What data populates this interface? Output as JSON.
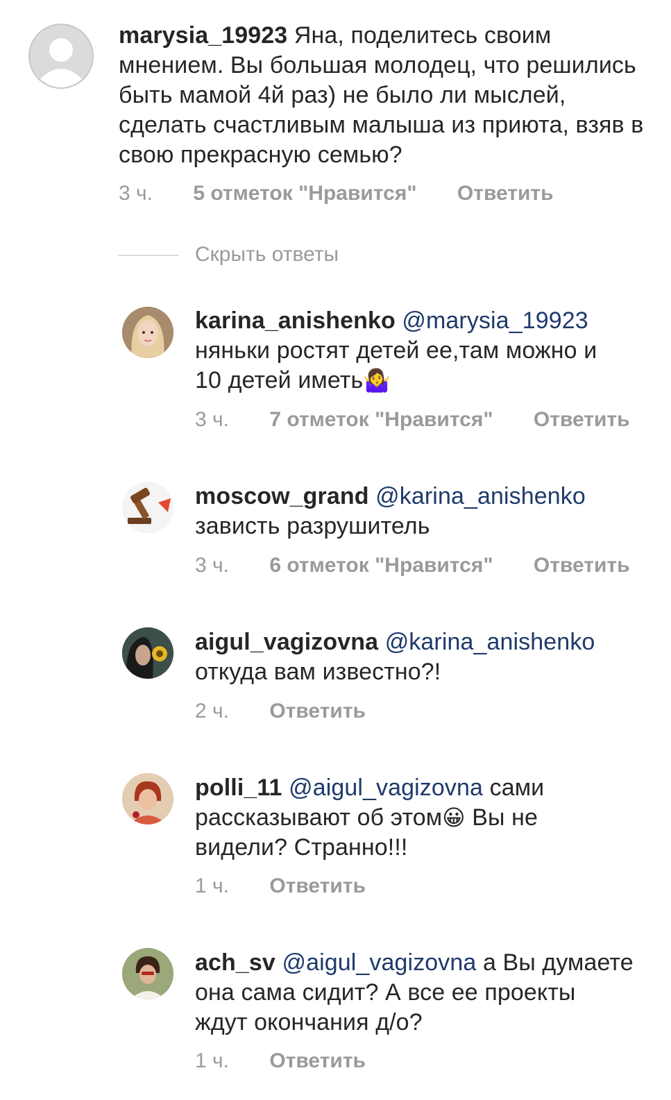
{
  "main_comment": {
    "username": "marysia_19923",
    "text": " Яна, поделитесь своим мнением. Вы большая молодец, что решились быть мамой 4й раз) не было ли мыслей, сделать счастливым малыша из приюта, взяв в свою прекрасную семью?",
    "time": "3 ч.",
    "likes": "5 отметок \"Нравится\"",
    "reply": "Ответить"
  },
  "hide_replies": "Скрыть ответы",
  "replies": [
    {
      "username": "karina_anishenko",
      "mention": "@marysia_19923",
      "text_line1": "няньки ростят детей ее,там можно и",
      "text_line2": "10 детей иметь",
      "emoji": "🤷‍♀️",
      "time": "3 ч.",
      "likes": "7 отметок \"Нравится\"",
      "reply": "Ответить"
    },
    {
      "username": "moscow_grand",
      "mention": "@karina_anishenko",
      "text": "зависть разрушитель",
      "time": "3 ч.",
      "likes": "6 отметок \"Нравится\"",
      "reply": "Ответить"
    },
    {
      "username": "aigul_vagizovna",
      "mention": "@karina_anishenko",
      "text": "откуда вам известно?!",
      "time": "2 ч.",
      "reply": "Ответить"
    },
    {
      "username": "polli_11",
      "mention": "@aigul_vagizovna",
      "text_a": " сами",
      "text_line2a": "рассказывают об этом",
      "emoji": "😀",
      "text_line2b": " Вы не",
      "text_line3": "видели? Странно!!!",
      "time": "1 ч.",
      "reply": "Ответить"
    },
    {
      "username": "ach_sv",
      "mention": "@aigul_vagizovna",
      "text_a": " а Вы думаете",
      "text_line2": "она сама сидит? А все ее проекты",
      "text_line3": "ждут окончания д/о?",
      "time": "1 ч.",
      "reply": "Ответить"
    }
  ]
}
